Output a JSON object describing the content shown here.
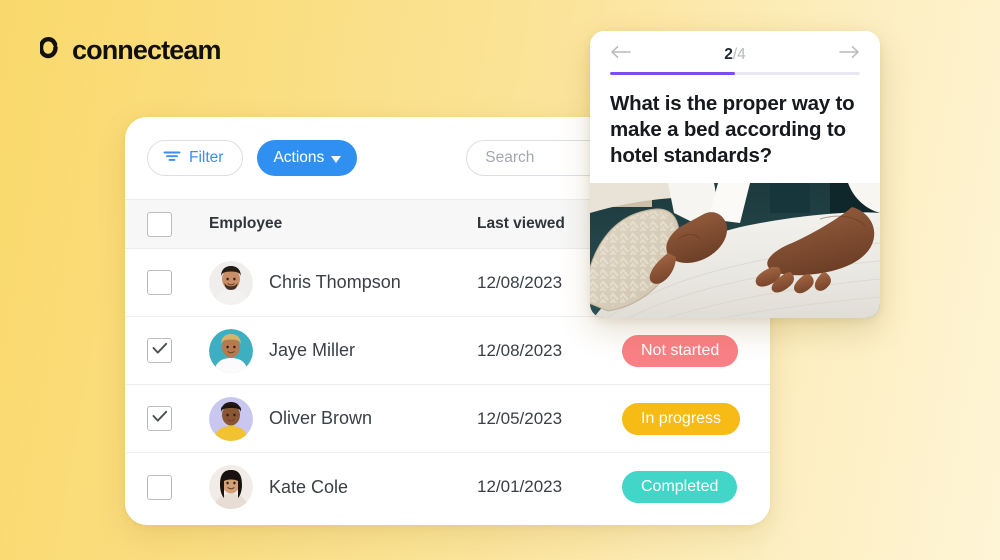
{
  "brand": {
    "logo_text": "connecteam",
    "accent_blue": "#2f90f2",
    "accent_purple": "#7a4ef0",
    "bg_yellow_left": "#f9d96c",
    "bg_yellow_right": "#fef5d6"
  },
  "toolbar": {
    "filter_label": "Filter",
    "filter_icon": "funnel-icon",
    "actions_label": "Actions",
    "actions_caret_icon": "chevron-down-icon",
    "search_placeholder": "Search",
    "search_value": ""
  },
  "table": {
    "columns": [
      "",
      "Employee",
      "Last viewed",
      ""
    ],
    "header": {
      "select_all_checked": false,
      "employee": "Employee",
      "last_viewed": "Last viewed"
    },
    "rows": [
      {
        "checked": false,
        "name": "Chris Thompson",
        "last_viewed": "12/08/2023",
        "status": "",
        "status_color": "",
        "avatar": "avatar-chris-thompson"
      },
      {
        "checked": true,
        "name": "Jaye Miller",
        "last_viewed": "12/08/2023",
        "status": "Not started",
        "status_color": "#fa8085",
        "avatar": "avatar-jaye-miller"
      },
      {
        "checked": true,
        "name": "Oliver Brown",
        "last_viewed": "12/05/2023",
        "status": "In progress",
        "status_color": "#f7bb16",
        "avatar": "avatar-oliver-brown"
      },
      {
        "checked": false,
        "name": "Kate Cole",
        "last_viewed": "12/01/2023",
        "status": "Completed",
        "status_color": "#41d6c7",
        "avatar": "avatar-kate-cole"
      }
    ]
  },
  "quiz": {
    "current": "2",
    "total": "/4",
    "progress_percent": 50,
    "back_icon": "arrow-left-icon",
    "next_icon": "arrow-right-icon",
    "question": "What is the proper way to make a bed according to hotel standards?",
    "photo_alt": "hands-making-bed-photo"
  }
}
